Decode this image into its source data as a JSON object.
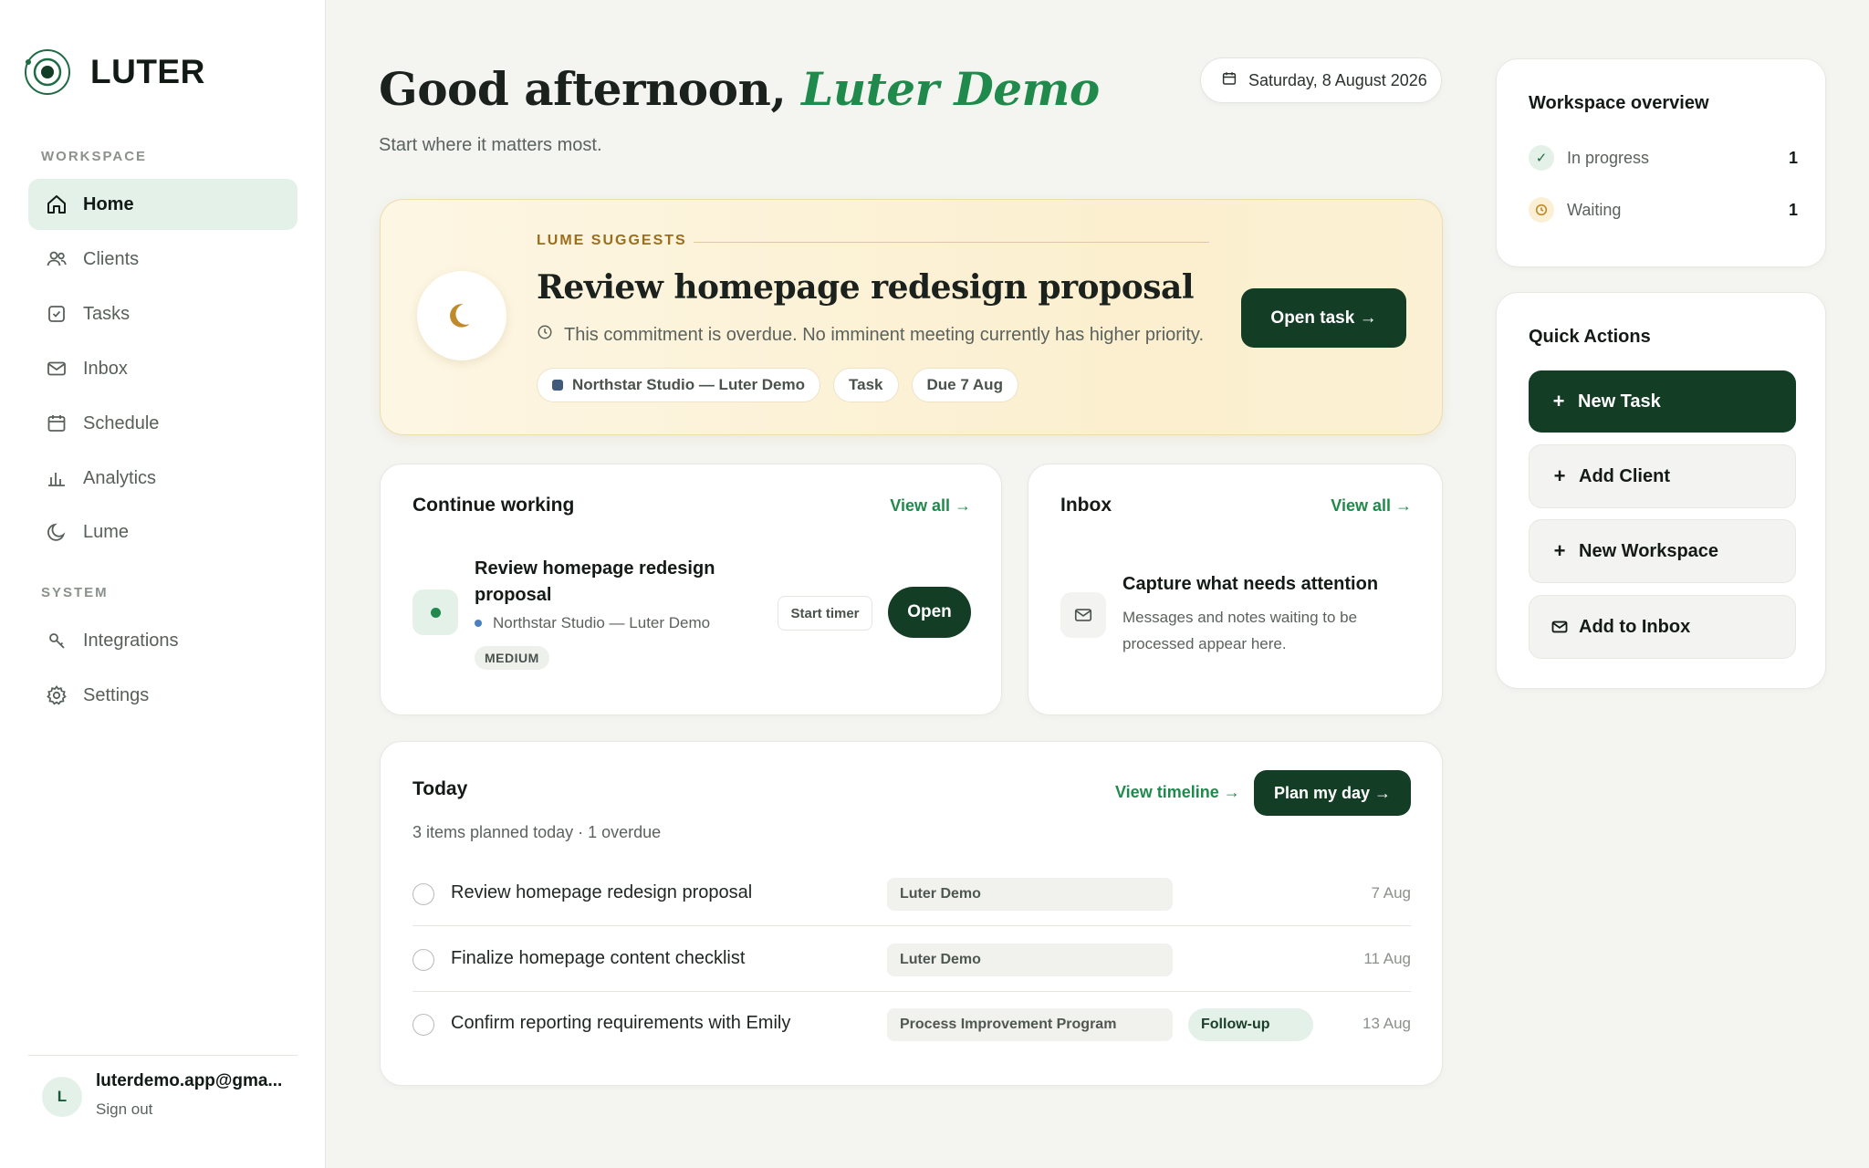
{
  "brand": {
    "name": "LUTER"
  },
  "sidebar": {
    "workspace_label": "WORKSPACE",
    "system_label": "SYSTEM",
    "workspace_items": [
      {
        "label": "Home",
        "icon": "home-icon",
        "active": true
      },
      {
        "label": "Clients",
        "icon": "users-icon"
      },
      {
        "label": "Tasks",
        "icon": "checkbox-icon"
      },
      {
        "label": "Inbox",
        "icon": "mail-icon"
      },
      {
        "label": "Schedule",
        "icon": "calendar-icon"
      },
      {
        "label": "Analytics",
        "icon": "bar-chart-icon"
      },
      {
        "label": "Lume",
        "icon": "moon-icon"
      }
    ],
    "system_items": [
      {
        "label": "Integrations",
        "icon": "key-icon"
      },
      {
        "label": "Settings",
        "icon": "gear-icon"
      }
    ],
    "user": {
      "initial": "L",
      "email": "luterdemo.app@gma...",
      "sign_out": "Sign out"
    }
  },
  "header": {
    "greeting": "Good afternoon,",
    "name": "Luter Demo",
    "subtitle": "Start where it matters most.",
    "date": "Saturday, 8 August 2026"
  },
  "suggest": {
    "label": "LUME SUGGESTS",
    "title": "Review homepage redesign proposal",
    "description": "This commitment is overdue. No imminent meeting currently has higher priority.",
    "chips": [
      "Northstar Studio — Luter Demo",
      "Task",
      "Due 7 Aug"
    ],
    "button": "Open task →"
  },
  "continue_working": {
    "title": "Continue working",
    "view_all": "View all →",
    "item": {
      "title": "Review homepage redesign proposal",
      "meta": "Northstar Studio — Luter Demo",
      "badge": "MEDIUM",
      "start_timer": "Start timer",
      "open": "Open"
    }
  },
  "inbox": {
    "title": "Inbox",
    "view_all": "View all →",
    "empty_title": "Capture what needs attention",
    "empty_body": "Messages and notes waiting to be processed appear here."
  },
  "today": {
    "title": "Today",
    "summary": "3 items planned today · 1 overdue",
    "view_timeline": "View timeline →",
    "plan_button": "Plan my day →",
    "rows": [
      {
        "title": "Review homepage redesign proposal",
        "project": "Luter Demo",
        "tag": "",
        "date": "7 Aug"
      },
      {
        "title": "Finalize homepage content checklist",
        "project": "Luter Demo",
        "tag": "",
        "date": "11 Aug"
      },
      {
        "title": "Confirm reporting requirements with Emily",
        "project": "Process Improvement Program",
        "tag": "Follow-up",
        "date": "13 Aug"
      }
    ]
  },
  "overview": {
    "title": "Workspace overview",
    "rows": [
      {
        "label": "In progress",
        "count": "1",
        "icon": "check-icon"
      },
      {
        "label": "Waiting",
        "count": "1",
        "icon": "clock-icon"
      }
    ]
  },
  "quick_actions": {
    "title": "Quick Actions",
    "items": [
      {
        "label": "New Task",
        "icon": "plus-icon"
      },
      {
        "label": "Add Client",
        "icon": "plus-icon"
      },
      {
        "label": "New Workspace",
        "icon": "plus-icon"
      },
      {
        "label": "Add to Inbox",
        "icon": "mail-icon"
      }
    ]
  },
  "colors": {
    "accent_green": "#1f8a4c",
    "dark_green": "#133d25",
    "gold": "#9a6e1c"
  }
}
